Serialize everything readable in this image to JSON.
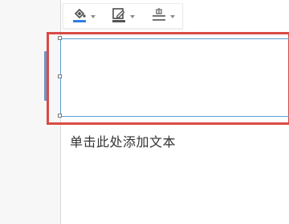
{
  "toolbar": {
    "tools": [
      {
        "name": "fill-color-icon",
        "accent": "#2f7de1"
      },
      {
        "name": "outline-color-icon",
        "accent": "#555555"
      },
      {
        "name": "text-align-icon",
        "accent": "#666666"
      }
    ]
  },
  "textbox": {
    "placeholder": "单击此处添加文本"
  },
  "colors": {
    "selection_frame": "#5e9ed6",
    "highlight": "#d94b43",
    "fill_accent": "#2f7de1"
  }
}
